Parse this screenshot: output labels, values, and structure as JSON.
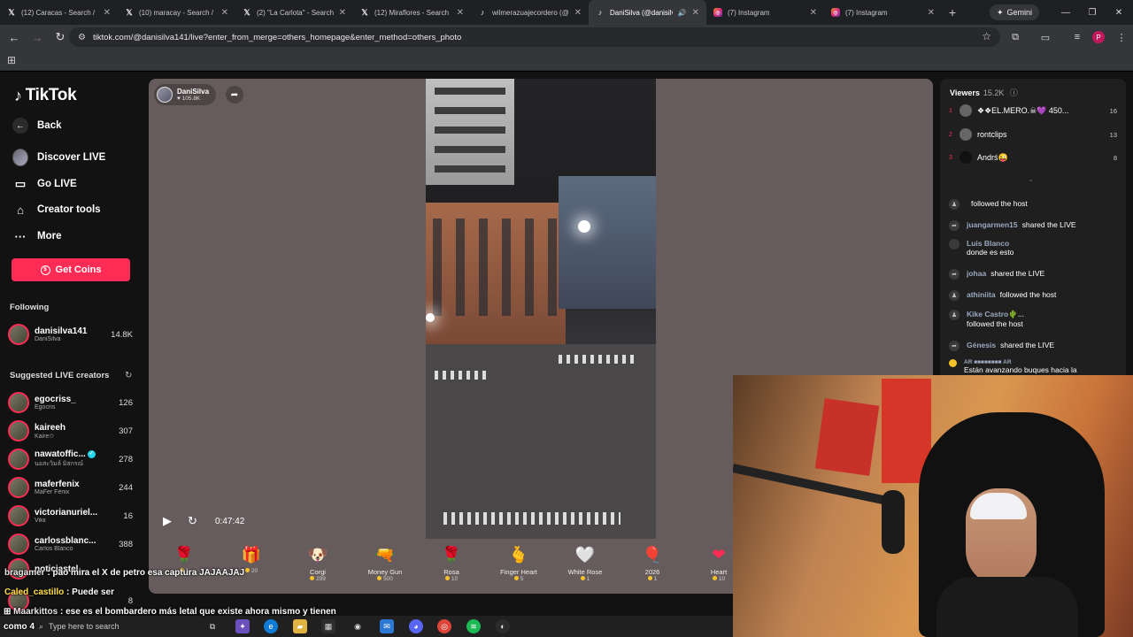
{
  "browser": {
    "tabs": [
      {
        "icon": "x-icon",
        "title": "(12) Caracas - Search /"
      },
      {
        "icon": "x-icon",
        "title": "(10) maracay - Search /"
      },
      {
        "icon": "x-icon",
        "title": "(2) \"La Carlota\" - Search"
      },
      {
        "icon": "x-icon",
        "title": "(12) Miraflores - Search"
      },
      {
        "icon": "tiktok-icon",
        "title": "wilmerazuajecordero (@"
      },
      {
        "icon": "tiktok-icon",
        "title": "DaniSilva (@danisilv"
      },
      {
        "icon": "instagram-icon",
        "title": "(7) Instagram"
      },
      {
        "icon": "instagram-icon",
        "title": "(7) Instagram"
      }
    ],
    "gemini_label": "Gemini",
    "url": "tiktok.com/@danisilva141/live?enter_from_merge=others_homepage&enter_method=others_photo",
    "profile_initial": "P"
  },
  "sidebar": {
    "logo": "TikTok",
    "nav": [
      {
        "icon": "back-icon",
        "label": "Back"
      },
      {
        "icon": "discover-live-icon",
        "label": "Discover LIVE"
      },
      {
        "icon": "video-camera-icon",
        "label": "Go LIVE"
      },
      {
        "icon": "creator-tools-icon",
        "label": "Creator tools"
      },
      {
        "icon": "more-icon",
        "label": "More"
      }
    ],
    "get_coins": "Get Coins",
    "following_header": "Following",
    "following": [
      {
        "handle": "danisilva141",
        "name": "DaniSilva",
        "count": "14.8K"
      }
    ],
    "suggested_header": "Suggested LIVE creators",
    "suggested": [
      {
        "handle": "egocriss_",
        "name": "Egocris",
        "count": "126"
      },
      {
        "handle": "kaireeh",
        "name": "Kaire✩",
        "count": "307"
      },
      {
        "handle": "nawatoffic...",
        "name": "นอสะวิมล์ มิสกรณ์",
        "count": "278"
      },
      {
        "handle": "maferfenix",
        "name": "MaFer Fénix",
        "count": "244"
      },
      {
        "handle": "victorianuriel...",
        "name": "Vikii",
        "count": "16"
      },
      {
        "handle": "carlossblanc...",
        "name": "Carlos Blanco",
        "count": "388"
      },
      {
        "handle": "noticiastel...",
        "name": "",
        "count": ""
      },
      {
        "handle": "",
        "name": "",
        "count": "8"
      }
    ]
  },
  "player": {
    "host_name": "DaniSilva",
    "host_likes": "♥ 105.8K",
    "elapsed": "0:47:42",
    "gifts": [
      {
        "name": "",
        "price": "1",
        "emoji": "🌹"
      },
      {
        "name": "",
        "price": "20",
        "emoji": "🎁"
      },
      {
        "name": "Corgi",
        "price": "299",
        "emoji": "🐶"
      },
      {
        "name": "Money Gun",
        "price": "500",
        "emoji": "🔫"
      },
      {
        "name": "Rosa",
        "price": "10",
        "emoji": "🌹"
      },
      {
        "name": "Finger Heart",
        "price": "5",
        "emoji": "🫰"
      },
      {
        "name": "White Rose",
        "price": "1",
        "emoji": "🤍"
      },
      {
        "name": "2026",
        "price": "1",
        "emoji": "🎈"
      },
      {
        "name": "Heart",
        "price": "10",
        "emoji": "❤"
      }
    ]
  },
  "viewers": {
    "label": "Viewers",
    "count": "15.2K",
    "top": [
      {
        "rank": "1",
        "name": "❖❖EL.MERO.☠💜 450...",
        "score": "16"
      },
      {
        "rank": "2",
        "name": "rontclips",
        "score": "13"
      },
      {
        "rank": "3",
        "name": "Andrś😜",
        "score": "8"
      }
    ]
  },
  "comments": [
    {
      "user": "",
      "text": "followed the host"
    },
    {
      "user": "juangarmen15",
      "text": "shared the LIVE"
    },
    {
      "user": "Luis Blanco",
      "text": "donde es esto"
    },
    {
      "user": "johaa",
      "text": "shared the LIVE"
    },
    {
      "user": "athiniita",
      "text": "followed the host"
    },
    {
      "user": "Kike Castro🌵...",
      "text": "followed the host"
    },
    {
      "user": "Génesis",
      "text": "shared the LIVE"
    },
    {
      "user": "AR ■■■■■■■■ AR",
      "text": "Están avanzando buques hacia la"
    }
  ],
  "overlay_chat": [
    {
      "user": "bragamer",
      "text": "pao mira el X de petro esa captura JAJAAJAJ"
    },
    {
      "user": "Caled_castillo",
      "text": "Puede ser"
    },
    {
      "user": "Maarkittos",
      "text": "ese es el bombardero más letal que existe ahora mismo y tienen"
    },
    {
      "user": "",
      "text": "como 4"
    }
  ],
  "taskbar": {
    "search_placeholder": "Type here to search"
  }
}
